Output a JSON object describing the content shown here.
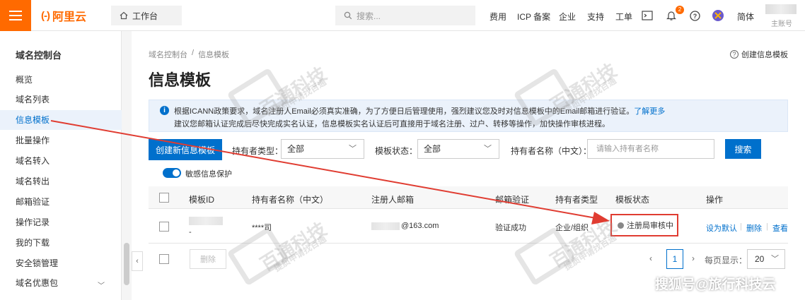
{
  "topbar": {
    "logo_text": "阿里云",
    "logo_mark": "(-)",
    "workbench": "工作台",
    "search_placeholder": "搜索...",
    "nav": [
      "费用",
      "ICP 备案",
      "企业",
      "支持",
      "工单"
    ],
    "notification_count": "2",
    "language": "简体",
    "account_sub": "主账号"
  },
  "sidebar": {
    "title": "域名控制台",
    "items": [
      "概览",
      "域名列表",
      "信息模板",
      "批量操作",
      "域名转入",
      "域名转出",
      "邮箱验证",
      "操作记录",
      "我的下载",
      "安全锁管理",
      "域名优惠包"
    ],
    "active_index": 2
  },
  "breadcrumb": {
    "root": "域名控制台",
    "sep": "/",
    "current": "信息模板"
  },
  "help_link": "创建信息模板",
  "page_title": "信息模板",
  "notice": {
    "line1": "根据ICANN政策要求，域名注册人Email必须真实准确，为了方便日后管理使用，强烈建议您及时对信息模板中的Email邮箱进行验证。",
    "line1_link": "了解更多",
    "line2": "建议您邮箱认证完成后尽快完成实名认证，信息模板实名认证后可直接用于域名注册、过户、转移等操作，加快操作审核进程。"
  },
  "toolbar": {
    "create_button": "创建新信息模板",
    "holder_type_label": "持有者类型：",
    "holder_type_value": "全部",
    "template_status_label": "模板状态：",
    "template_status_value": "全部",
    "holder_name_label": "持有者名称（中文）：",
    "holder_name_placeholder": "请输入持有者名称",
    "search_button": "搜索",
    "toggle_label": "敏感信息保护",
    "toggle_on": true
  },
  "table": {
    "columns": [
      "模板ID",
      "持有者名称（中文）",
      "注册人邮箱",
      "邮箱验证",
      "持有者类型",
      "模板状态",
      "操作"
    ],
    "rows": [
      {
        "template_id_suffix": "-",
        "holder_name": "****司",
        "email": "@163.com",
        "email_verified": "验证成功",
        "holder_type": "企业/组织",
        "status": "注册局审核中",
        "actions": [
          "设为默认",
          "删除",
          "查看"
        ]
      }
    ]
  },
  "footer": {
    "delete_button": "删除",
    "current_page": "1",
    "page_size_label": "每页显示：",
    "page_size": "20"
  },
  "watermarks": {
    "brand": "百通科技",
    "slogan": "提质申请找百通",
    "logo": "BB",
    "source": "搜狐号@旅行科技云"
  },
  "colors": {
    "accent": "#0070cc",
    "brand": "#ff6a00",
    "annotation_red": "#e03c31"
  }
}
